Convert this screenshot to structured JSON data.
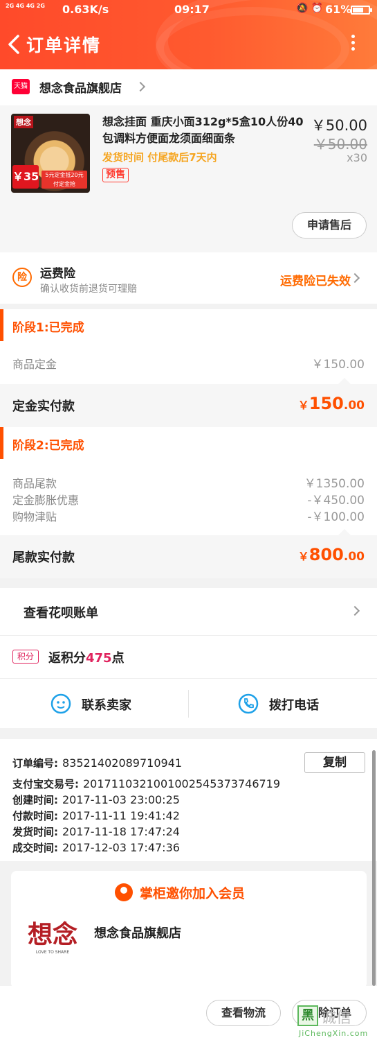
{
  "status_bar": {
    "signal": "2G 4G 4G 2G",
    "speed": "0.63K/s",
    "time": "09:17",
    "battery": "61%",
    "battery_level": 0.61
  },
  "header": {
    "title": "订单详情"
  },
  "store": {
    "badge": "天猫",
    "name": "想念食品旗舰店"
  },
  "product": {
    "title": "想念挂面 重庆小面312g*5盒10人份40包调料方便面龙须面细面条",
    "ship_time": "发货时间 付尾款后7天内",
    "tag": "预售",
    "price": "￥50.00",
    "original_price": "￥50.00",
    "quantity": "x30",
    "thumb_brand": "想念",
    "thumb_price": "￥35",
    "thumb_strip_1": "5元定金抵20元",
    "thumb_strip_2": "付定金抢",
    "after_sale_button": "申请售后"
  },
  "insurance": {
    "icon_text": "险",
    "title": "运费险",
    "subtitle": "确认收货前退货可理赔",
    "status": "运费险已失效"
  },
  "stage1": {
    "title": "阶段1:已完成",
    "rows": [
      {
        "label": "商品定金",
        "value": "￥150.00"
      }
    ],
    "pay_label": "定金实付款",
    "pay_currency": "￥",
    "pay_int": "150",
    "pay_dec": ".00"
  },
  "stage2": {
    "title": "阶段2:已完成",
    "rows": [
      {
        "label": "商品尾款",
        "value": "￥1350.00"
      },
      {
        "label": "定金膨胀优惠",
        "value": "-￥450.00"
      },
      {
        "label": "购物津贴",
        "value": "-￥100.00"
      }
    ],
    "pay_label": "尾款实付款",
    "pay_currency": "￥",
    "pay_int": "800",
    "pay_dec": ".00"
  },
  "huabei": {
    "label": "查看花呗账单"
  },
  "points": {
    "tag": "积分",
    "prefix": "返积分",
    "number": "475",
    "suffix": "点"
  },
  "contact": {
    "seller": "联系卖家",
    "phone": "拨打电话"
  },
  "order_info": {
    "order_no_label": "订单编号:",
    "order_no": "83521402089710941",
    "copy_button": "复制",
    "alipay_label": "支付宝交易号:",
    "alipay_no": "2017110321001002545373746719",
    "created_label": "创建时间:",
    "created": "2017-11-03 23:00:25",
    "paid_label": "付款时间:",
    "paid": "2017-11-11 19:41:42",
    "shipped_label": "发货时间:",
    "shipped": "2017-11-18 17:47:24",
    "completed_label": "成交时间:",
    "completed": "2017-12-03 17:47:36"
  },
  "member": {
    "title": "掌柜邀你加入会员",
    "logo_text": "想念",
    "logo_sub": "LOVE TO SHARE",
    "store_name": "想念食品旗舰店"
  },
  "bottom_bar": {
    "logistics_button": "查看物流",
    "delete_button": "删除订单"
  },
  "watermark": {
    "box": "黑",
    "text": "诚信",
    "url": "JiChengXin.com"
  },
  "colors": {
    "accent": "#ff5000",
    "header_gradient_start": "#ff4a2a",
    "header_gradient_end": "#ff7b3a",
    "points": "#e0245e"
  }
}
